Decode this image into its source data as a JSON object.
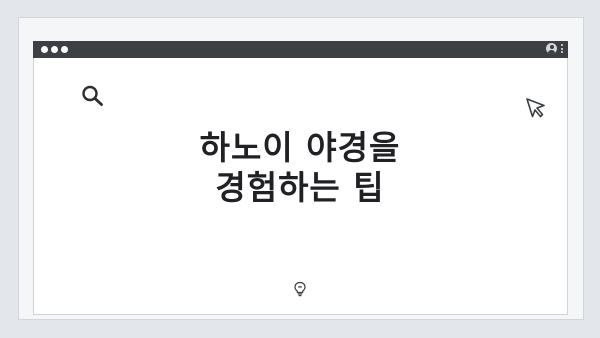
{
  "window": {
    "titlebar_dots": 3
  },
  "icons": {
    "search": "search-icon",
    "cursor": "cursor-icon",
    "lightbulb": "lightbulb-icon",
    "user": "user-icon",
    "menu": "kebab-menu-icon"
  },
  "content": {
    "headline_line1": "하노이 야경을",
    "headline_line2": "경험하는 팁"
  },
  "colors": {
    "titlebar": "#3c3f44",
    "background": "#e3e6ea",
    "text": "#202124"
  }
}
